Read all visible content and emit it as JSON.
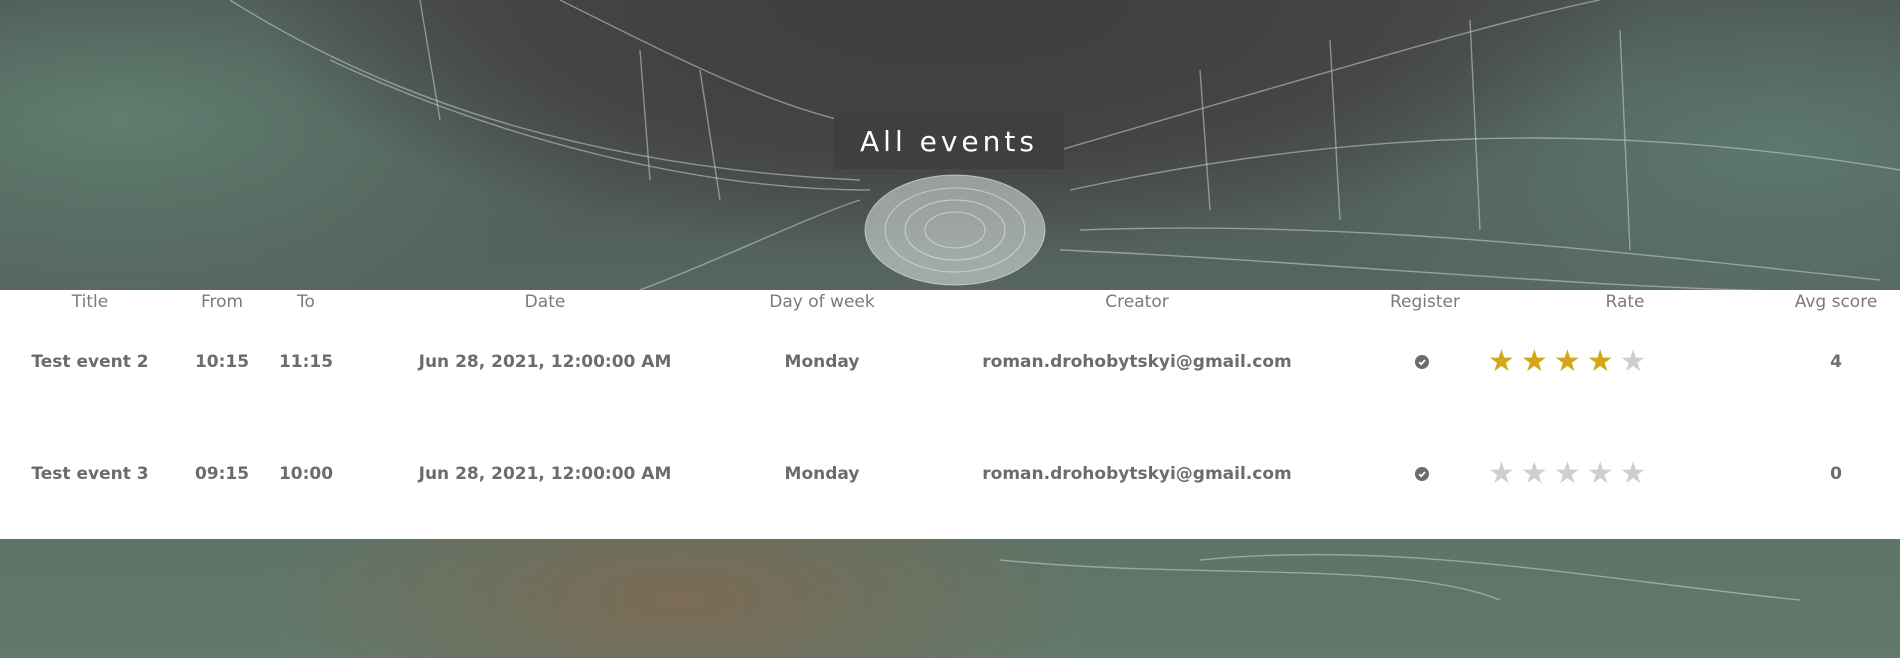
{
  "page_title": "All events",
  "table": {
    "headers": {
      "title": "Title",
      "from": "From",
      "to": "To",
      "date": "Date",
      "day": "Day of week",
      "creator": "Creator",
      "register": "Register",
      "rate": "Rate",
      "avg": "Avg score"
    },
    "rows": [
      {
        "title": "Test event 2",
        "from": "10:15",
        "to": "11:15",
        "date": "Jun 28, 2021, 12:00:00 AM",
        "day": "Monday",
        "creator": "roman.drohobytskyi@gmail.com",
        "registered": true,
        "rating": 4,
        "rating_max": 5,
        "avg": "4"
      },
      {
        "title": "Test event 3",
        "from": "09:15",
        "to": "10:00",
        "date": "Jun 28, 2021, 12:00:00 AM",
        "day": "Monday",
        "creator": "roman.drohobytskyi@gmail.com",
        "registered": true,
        "rating": 0,
        "rating_max": 5,
        "avg": "0"
      }
    ]
  },
  "icons": {
    "register": "check-circle-icon",
    "rate": "star-icon"
  },
  "colors": {
    "star_on": "#d4a61a",
    "star_off": "#cfcfcf",
    "text": "#6c6c6c",
    "header_text": "#7a7a7a",
    "title_bg": "#3f3f3f"
  }
}
